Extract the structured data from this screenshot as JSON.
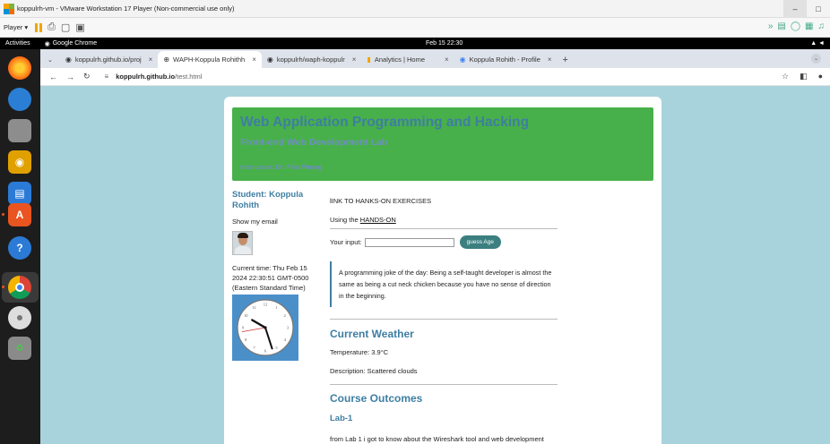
{
  "vmware": {
    "title": "koppulrh-vm - VMware Workstation 17 Player (Non-commercial use only)",
    "player_label": "Player ▾",
    "minimize": "–",
    "restore": "□"
  },
  "ubuntu": {
    "activities": "Activities",
    "app_name": "Google Chrome",
    "clock": "Feb 15  22:30"
  },
  "chrome": {
    "tabs": [
      {
        "label": "koppulrh.github.io/proj",
        "icon": "github-icon"
      },
      {
        "label": "WAPH-Koppula Rohithh",
        "icon": "globe-icon"
      },
      {
        "label": "koppulrh/waph-koppulr",
        "icon": "github-icon"
      },
      {
        "label": "Analytics | Home",
        "icon": "analytics-icon"
      },
      {
        "label": "Koppula Rohith - Profile",
        "icon": "scholar-icon"
      }
    ],
    "close_glyph": "×",
    "new_tab": "+",
    "url_host": "koppulrh.github.io",
    "url_path": "/test.html"
  },
  "page": {
    "header_title": "Web Application Programming and Hacking",
    "header_subtitle": "Front-end Web Development Lab",
    "instructor": "Instructor: Dr. Phu Phung",
    "student": "Student: Koppula Rohith",
    "show_email": "Show my email",
    "current_time": "Current time: Thu Feb 15 2024 22:30:51 GMT-0500 (Eastern Standard Time)",
    "link_heading": "lINK TO HANKS-ON EXERCISES",
    "using_prefix": "Using the ",
    "hands_on": "HANDS-ON",
    "input_label": "Your input:",
    "guess_button": "guess Age",
    "joke": "A programming joke of the day: Being a self-taught developer is almost the same as being a cut neck chicken because you have no sense of direction in the beginning.",
    "weather_title": "Current Weather",
    "temperature": "Temperature: 3.9°C",
    "description": "Description: Scattered clouds",
    "outcomes_title": "Course Outcomes",
    "lab1_title": "Lab-1",
    "lab1_text": "from Lab 1 i got to know about the Wireshark tool and web development"
  },
  "colors": {
    "accent": "#3e7ea3",
    "header_bg": "#48b04a",
    "page_bg": "#a9d3dc",
    "clock_bg": "#4b8fc9",
    "button_bg": "#3b7f80"
  }
}
